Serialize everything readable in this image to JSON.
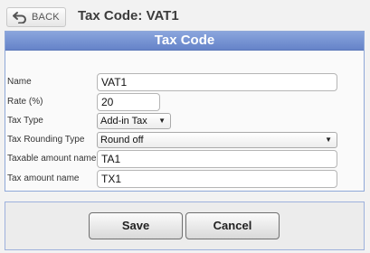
{
  "header": {
    "back_label": "BACK",
    "title": "Tax Code: VAT1"
  },
  "panel": {
    "title": "Tax Code",
    "fields": {
      "name": {
        "label": "Name",
        "value": "VAT1"
      },
      "rate": {
        "label": "Rate (%)",
        "value": "20"
      },
      "tax_type": {
        "label": "Tax Type",
        "value": "Add-in Tax"
      },
      "rounding": {
        "label": "Tax Rounding Type",
        "value": "Round off"
      },
      "taxable_name": {
        "label": "Taxable amount name",
        "value": "TA1"
      },
      "tax_amount_name": {
        "label": "Tax amount name",
        "value": "TX1"
      }
    }
  },
  "footer": {
    "save_label": "Save",
    "cancel_label": "Cancel"
  },
  "icons": {
    "back": "undo-arrow-icon",
    "dropdown": "chevron-down-icon"
  },
  "colors": {
    "header_accent": "#6f8bd0"
  }
}
